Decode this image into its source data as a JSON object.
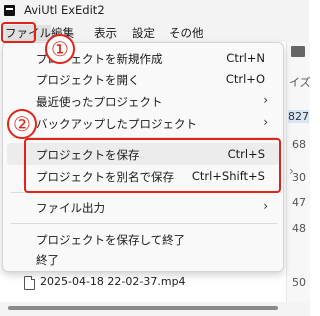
{
  "window": {
    "title": "AviUtl ExEdit2"
  },
  "menubar": [
    {
      "label": "ファイル",
      "active": true
    },
    {
      "label": "編集"
    },
    {
      "label": "表示"
    },
    {
      "label": "設定"
    },
    {
      "label": "その他"
    }
  ],
  "file_menu": {
    "items": [
      {
        "label": "プロジェクトを新規作成",
        "shortcut": "Ctrl+N"
      },
      {
        "label": "プロジェクトを開く",
        "shortcut": "Ctrl+O"
      },
      {
        "label": "最近使ったプロジェクト",
        "submenu_arrow": "›"
      },
      {
        "label": "バックアップしたプロジェクト",
        "submenu_arrow": "›"
      },
      {
        "label": "プロジェクトを保存",
        "shortcut": "Ctrl+S",
        "highlighted": true
      },
      {
        "label": "プロジェクトを別名で保存",
        "shortcut": "Ctrl+Shift+S"
      },
      {
        "label": "ファイル出力",
        "submenu_arrow": "›"
      },
      {
        "label": "プロジェクトを保存して終了"
      },
      {
        "label": "終了"
      }
    ]
  },
  "background": {
    "col_header_partial": "イズ",
    "sizes": [
      "827",
      "68",
      "30",
      "47",
      "48",
      "50"
    ],
    "file_name": "2025-04-18 22-02-37.mp4",
    "chevron": "›"
  },
  "annotations": {
    "step1": "①",
    "step2": "②",
    "color": "#e2231a"
  }
}
